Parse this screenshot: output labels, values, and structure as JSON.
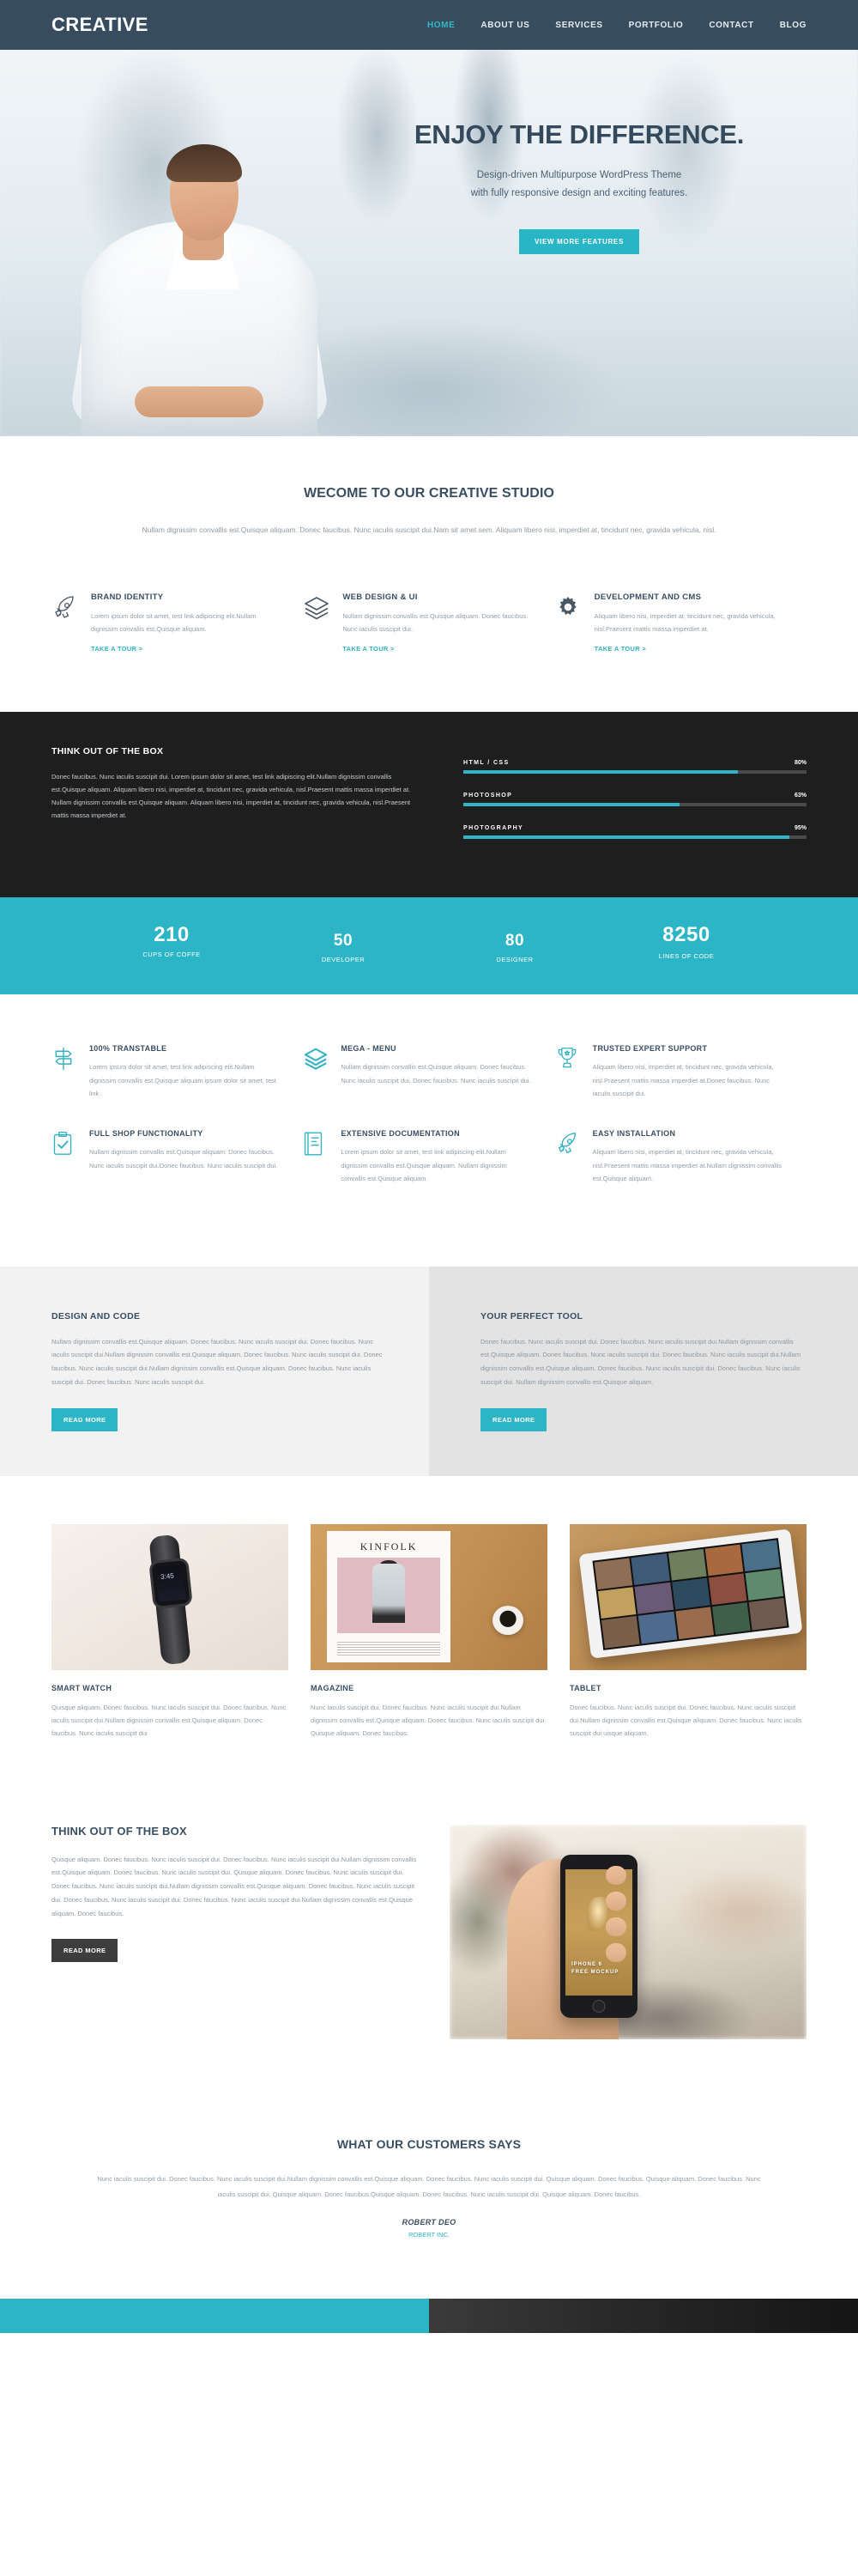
{
  "header": {
    "brand": "CREATIVE",
    "nav": [
      {
        "label": "HOME",
        "active": true
      },
      {
        "label": "ABOUT US",
        "active": false
      },
      {
        "label": "SERVICES",
        "active": false
      },
      {
        "label": "PORTFOLIO",
        "active": false
      },
      {
        "label": "CONTACT",
        "active": false
      },
      {
        "label": "BLOG",
        "active": false
      }
    ]
  },
  "hero": {
    "title": "ENJOY THE DIFFERENCE.",
    "sub_line1": "Design-driven Multipurpose WordPress Theme",
    "sub_line2": "with fully responsive design and exciting features.",
    "cta": "VIEW MORE FEATURES"
  },
  "welcome": {
    "title": "WECOME TO OUR CREATIVE STUDIO",
    "text": "Nullam dignissim convallis est.Quisque aliquam. Donec faucibus. Nunc iaculis suscipit dui.Nam sit amet sem. Aliquam libero nisi, imperdiet at, tincidunt nec, gravida vehicula, nisl."
  },
  "services": [
    {
      "icon": "rocket-icon",
      "title": "BRAND IDENTITY",
      "text": "Lorem ipsum dolor sit amet, test link adipiscing elit.Nullam dignissim convallis est.Quisque aliquam.",
      "link": "TAKE A TOUR >"
    },
    {
      "icon": "layers-icon",
      "title": "WEB DESIGN & UI",
      "text": "Nullam dignissim convallis est.Quisque aliquam. Donec faucibus. Nunc iaculis suscipit dui.",
      "link": "TAKE A TOUR >"
    },
    {
      "icon": "gear-icon",
      "title": "DEVELOPMENT AND CMS",
      "text": "Aliquam libero nisi, imperdiet at, tincidunt nec, gravida vehicula, nisl.Praesent mattis massa imperdiet at.",
      "link": "TAKE A TOUR >"
    }
  ],
  "skills": {
    "title": "THINK OUT OF THE BOX",
    "text": "Donec faucibus. Nunc iaculis suscipit dui. Lorem ipsum dolor sit amet, test link adipiscing elit.Nullam dignissim convallis est.Quisque aliquam. Aliquam libero nisi, imperdiet at, tincidunt nec, gravida vehicula, nisl.Praesent mattis massa imperdiet at. Nullam dignissim convallis est.Quisque aliquam. Aliquam libero nisi, imperdiet at, tincidunt nec, gravida vehicula, nisl.Praesent mattis massa imperdiet at.",
    "bars": [
      {
        "label": "HTML / CSS",
        "pct": "80%",
        "value": 80
      },
      {
        "label": "PHOTOSHOP",
        "pct": "63%",
        "value": 63
      },
      {
        "label": "PHOTOGRAPHY",
        "pct": "95%",
        "value": 95
      }
    ],
    "bar_color": "#2fb5c6",
    "track_color": "#4a4a4a"
  },
  "counters": [
    {
      "num": "210",
      "label": "CUPS OF COFFE"
    },
    {
      "num": "50",
      "label": "DEVELOPER"
    },
    {
      "num": "80",
      "label": "DESIGNER"
    },
    {
      "num": "8250",
      "label": "LINES OF CODE"
    }
  ],
  "counters_bg": "#2cb5c6",
  "features": [
    {
      "icon": "signpost-icon",
      "title": "100% TRANSTABLE",
      "text": "Lorem ipsum dolor sit amet, test link adipiscing elit.Nullam dignissim convallis est.Quisque aliquam ipsum dolor sit amet, test link ."
    },
    {
      "icon": "layers-icon",
      "title": "MEGA - MENU",
      "text": "Nullam dignissim convallis est.Quisque aliquam. Donec faucibus. Nunc iaculis suscipit dui. Donec faucibus. Nunc iaculis suscipit dui."
    },
    {
      "icon": "trophy-icon",
      "title": "TRUSTED EXPERT SUPPORT",
      "text": "Aliquam libero nisi, imperdiet at, tincidunt nec, gravida vehicula, nisl.Praesent mattis massa imperdiet at.Donec faucibus. Nunc iaculis suscipit dui."
    },
    {
      "icon": "clipboard-check-icon",
      "title": "FULL SHOP FUNCTIONALITY",
      "text": "Nullam dignissim convallis est.Quisque aliquam. Donec faucibus. Nunc iaculis suscipit dui.Donec faucibus. Nunc iaculis suscipit dui."
    },
    {
      "icon": "book-icon",
      "title": "EXTENSIVE DOCUMENTATION",
      "text": "Lorem ipsum dolor sit amet, test link adipiscing elit.Nullam dignissim convallis est.Quisque aliquam. Nullam dignissim convallis est.Quisque aliquam."
    },
    {
      "icon": "rocket-icon",
      "title": "EASY INSTALLATION",
      "text": "Aliquam libero nisi, imperdiet at, tincidunt nec, gravida vehicula, nisl.Praesent mattis massa imperdiet at.Nullam dignissim convallis est.Quisque aliquam."
    }
  ],
  "panels": [
    {
      "title": "DESIGN AND CODE",
      "text": "Nullam dignissim convallis est.Quisque aliquam. Donec faucibus. Nunc iaculis suscipit dui. Donec faucibus. Nunc iaculis suscipit dui.Nullam dignissim convallis est.Quisque aliquam. Donec faucibus. Nunc iaculis suscipit dui. Donec faucibus. Nunc iaculis suscipit dui.Nullam dignissim convallis est.Quisque aliquam. Donec faucibus. Nunc iaculis suscipit dui. Donec faucibus. Nunc iaculis suscipit dui.",
      "button": "READ MORE"
    },
    {
      "title": "YOUR PERFECT TOOL",
      "text": "Donec faucibus. Nunc iaculis suscipit dui. Donec faucibus. Nunc iaculis suscipit dui.Nullam dignissim convallis est.Quisque aliquam. Donec faucibus. Nunc iaculis suscipit dui. Donec faucibus. Nunc iaculis suscipit dui.Nullam dignissim convallis est.Quisque aliquam. Donec faucibus. Nunc iaculis suscipit dui. Donec faucibus. Nunc iaculis suscipit dui. Nullam dignissim convallis est.Quisque aliquam.",
      "button": "READ MORE"
    }
  ],
  "portfolio": [
    {
      "image": "smart-watch-photo",
      "title": "SMART WATCH",
      "text": "Quisque aliquam. Donec faucibus. Nunc iaculis suscipit dui. Donec faucibus. Nunc iaculis suscipit dui.Nullam dignissim convallis est.Quisque aliquam. Donec faucibus. Nunc iaculis suscipit dui",
      "overlay_time": "3:45"
    },
    {
      "image": "magazine-photo",
      "title": "MAGAZINE",
      "text": "Nunc iaculis suscipit dui. Donec faucibus. Nunc iaculis suscipit dui.Nullam dignissim convallis est.Quisque aliquam. Donec faucibus. Nunc iaculis suscipit dui. Quisque aliquam. Donec faucibus.",
      "cover_title": "KINFOLK"
    },
    {
      "image": "tablet-photo",
      "title": "TABLET",
      "text": "Donec faucibus. Nunc iaculis suscipit dui. Donec faucibus. Nunc iaculis suscipit dui.Nullam dignissim convallis est.Quisque aliquam. Donec faucibus. Nunc iaculis suscipit dui uisque aliquam."
    }
  ],
  "thinkbox": {
    "title": "THINK OUT OF THE BOX",
    "text": "Quisque aliquam. Donec faucibus. Nunc iaculis suscipit dui. Donec faucibus. Nunc iaculis suscipit dui.Nullam dignissim convallis est.Quisque aliquam. Donec faucibus. Nunc iaculis suscipit dui. Quisque aliquam. Donec faucibus. Nunc iaculis suscipit dui. Donec faucibus. Nunc iaculis suscipit dui.Nullam dignissim convallis est.Quisque aliquam. Donec faucibus. Nunc iaculis suscipit dui. Donec faucibus. Nunc iaculis suscipit dui. Donec faucibus. Nunc iaculis suscipit dui.Nullam dignissim convallis est.Quisque aliquam. Donec faucibus.",
    "button": "READ MORE",
    "phone_caption_line1": "IPHONE 6",
    "phone_caption_line2": "FREE MOCKUP"
  },
  "testimonial": {
    "title": "WHAT OUR CUSTOMERS SAYS",
    "text": "Nunc iaculis suscipit dui. Donec faucibus. Nunc iaculis suscipit dui.Nullam dignissim convallis est.Quisque aliquam. Donec faucibus. Nunc iaculis suscipit dui. Quisque aliquam. Donec faucibus. Quisque aliquam. Donec faucibus. Nunc iaculis suscipit dui. Quisque aliquam. Donec faucibus.Quisque aliquam. Donec faucibus. Nunc iaculis suscipit dui. Quisque aliquam. Donec faucibus.",
    "author": "ROBERT DEO",
    "company": "ROBERT INC."
  },
  "colors": {
    "accent": "#2cb5c6",
    "header_bg": "#374d5f",
    "dark_bg": "#1e1e1e",
    "heading": "#3a4e62"
  }
}
